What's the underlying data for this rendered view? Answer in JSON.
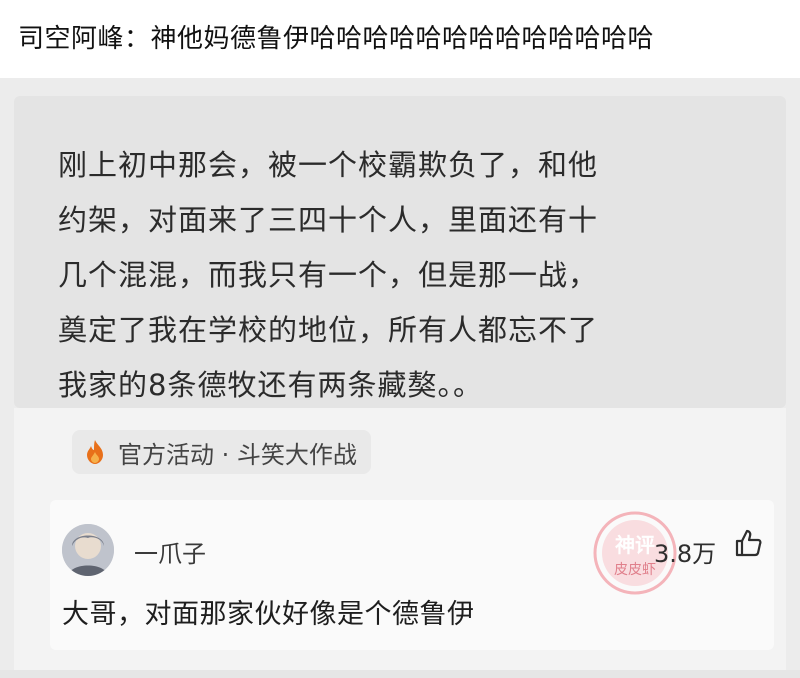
{
  "caption": "司空阿峰：神他妈德鲁伊哈哈哈哈哈哈哈哈哈哈哈哈哈",
  "post": {
    "lines": [
      "刚上初中那会，被一个校霸欺负了，和他",
      "约架，对面来了三四十个人，里面还有十",
      "几个混混，而我只有一个，但是那一战，",
      "奠定了我在学校的地位，所有人都忘不了",
      "我家的8条德牧还有两条藏獒。。"
    ]
  },
  "activity": {
    "icon": "flame-icon",
    "label": "官方活动 · 斗笑大作战",
    "color": "#e8701a"
  },
  "comment": {
    "username": "一爪子",
    "likes": "3.8万",
    "text": "大哥，对面那家伙好像是个德鲁伊",
    "watermark": {
      "line1": "神评",
      "line2": "皮皮虾",
      "color": "#f3a2aa"
    }
  }
}
